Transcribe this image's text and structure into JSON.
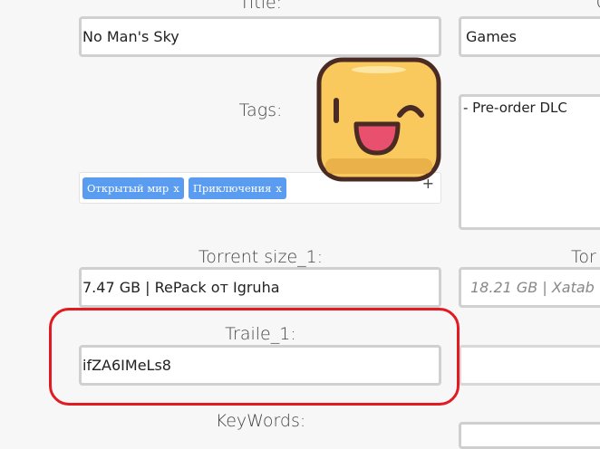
{
  "form": {
    "title_label": "Title:",
    "title_value": "No Man's Sky",
    "category_value": "Games",
    "tags_label": "Tags:",
    "tags": [
      {
        "label": "Открытый мир",
        "remove": "x"
      },
      {
        "label": "Приключения",
        "remove": "x"
      }
    ],
    "tags_add": "+",
    "dlc_value": "- Pre-order DLC",
    "torrent_size_label": "Torrent size_1:",
    "torrent_size_value": "7.47 GB | RePack от Igruha",
    "torrent_size_label_2": "Tor",
    "torrent_size_placeholder_2": "18.21 GB | Xatab",
    "trailer_label": "Traile_1:",
    "trailer_value": "ifZA6IMeLs8",
    "keywords_label": "KeyWords:"
  },
  "colors": {
    "highlight": "#e21b23",
    "tag": "#5a9cf0",
    "mascot_face": "#f9c95e",
    "mascot_outline": "#4a2b24",
    "mascot_tongue": "#e8506e"
  },
  "icons": {
    "mascot": "winking-face-icon"
  }
}
